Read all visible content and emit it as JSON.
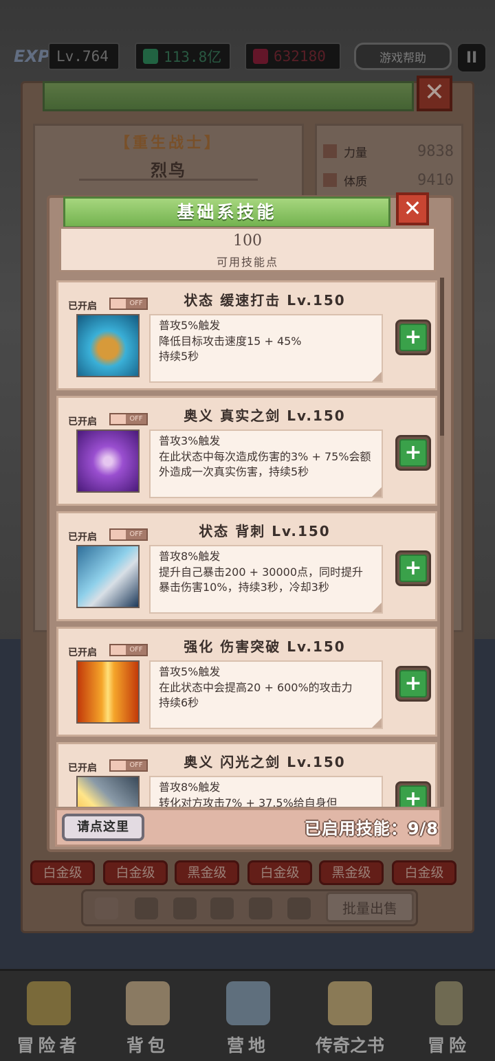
{
  "hud": {
    "exp_tag": "EXP",
    "level": "Lv.764",
    "currency_green": "113.8亿",
    "currency_red": "632180",
    "help_label": "游戏帮助",
    "pause_symbol": "II"
  },
  "character": {
    "class_name": "【重生战士】",
    "name": "烈鸟",
    "stats": [
      {
        "label": "力量",
        "value": "9838"
      },
      {
        "label": "体质",
        "value": "9410"
      }
    ]
  },
  "tiers": [
    "白金级",
    "白金级",
    "黑金级",
    "白金级",
    "黑金级",
    "白金级"
  ],
  "batch_sell": "批量出售",
  "skills_modal": {
    "title": "基础系技能",
    "close": "✕",
    "points_value": "100",
    "points_label": "可用技能点",
    "skills": [
      {
        "enabled_label": "已开启",
        "toggle_text": "OFF",
        "name": "状态 缓速打击 Lv.150",
        "desc": "普攻5%触发\n降低目标攻击速度15 + 45%\n持续5秒"
      },
      {
        "enabled_label": "已开启",
        "toggle_text": "OFF",
        "name": "奥义 真实之剑 Lv.150",
        "desc": "普攻3%触发\n在此状态中每次造成伤害的3% + 75%会额外造成一次真实伤害，持续5秒"
      },
      {
        "enabled_label": "已开启",
        "toggle_text": "OFF",
        "name": "状态 背刺 Lv.150",
        "desc": "普攻8%触发\n提升自己暴击200 + 30000点，同时提升暴击伤害10%，持续3秒，冷却3秒"
      },
      {
        "enabled_label": "已开启",
        "toggle_text": "OFF",
        "name": "强化 伤害突破 Lv.150",
        "desc": "普攻5%触发\n在此状态中会提高20 + 600%的攻击力\n持续6秒"
      },
      {
        "enabled_label": "已开启",
        "toggle_text": "OFF",
        "name": "奥义 闪光之剑 Lv.150",
        "desc": "普攻8%触发\n转化对方攻击7% + 37.5%给自身但"
      }
    ],
    "add_symbol": "+",
    "footer": {
      "click_here": "请点这里",
      "enabled_count": "已启用技能：9/8"
    }
  },
  "bottom_nav": [
    {
      "label": "冒险者"
    },
    {
      "label": "背包"
    },
    {
      "label": "营地"
    },
    {
      "label": "传奇之书"
    },
    {
      "label": "冒险"
    }
  ],
  "colors": {
    "title_green": "#74b350",
    "close_red": "#c84532",
    "add_green": "#3aa14a",
    "card_bg": "#f1dccd"
  }
}
